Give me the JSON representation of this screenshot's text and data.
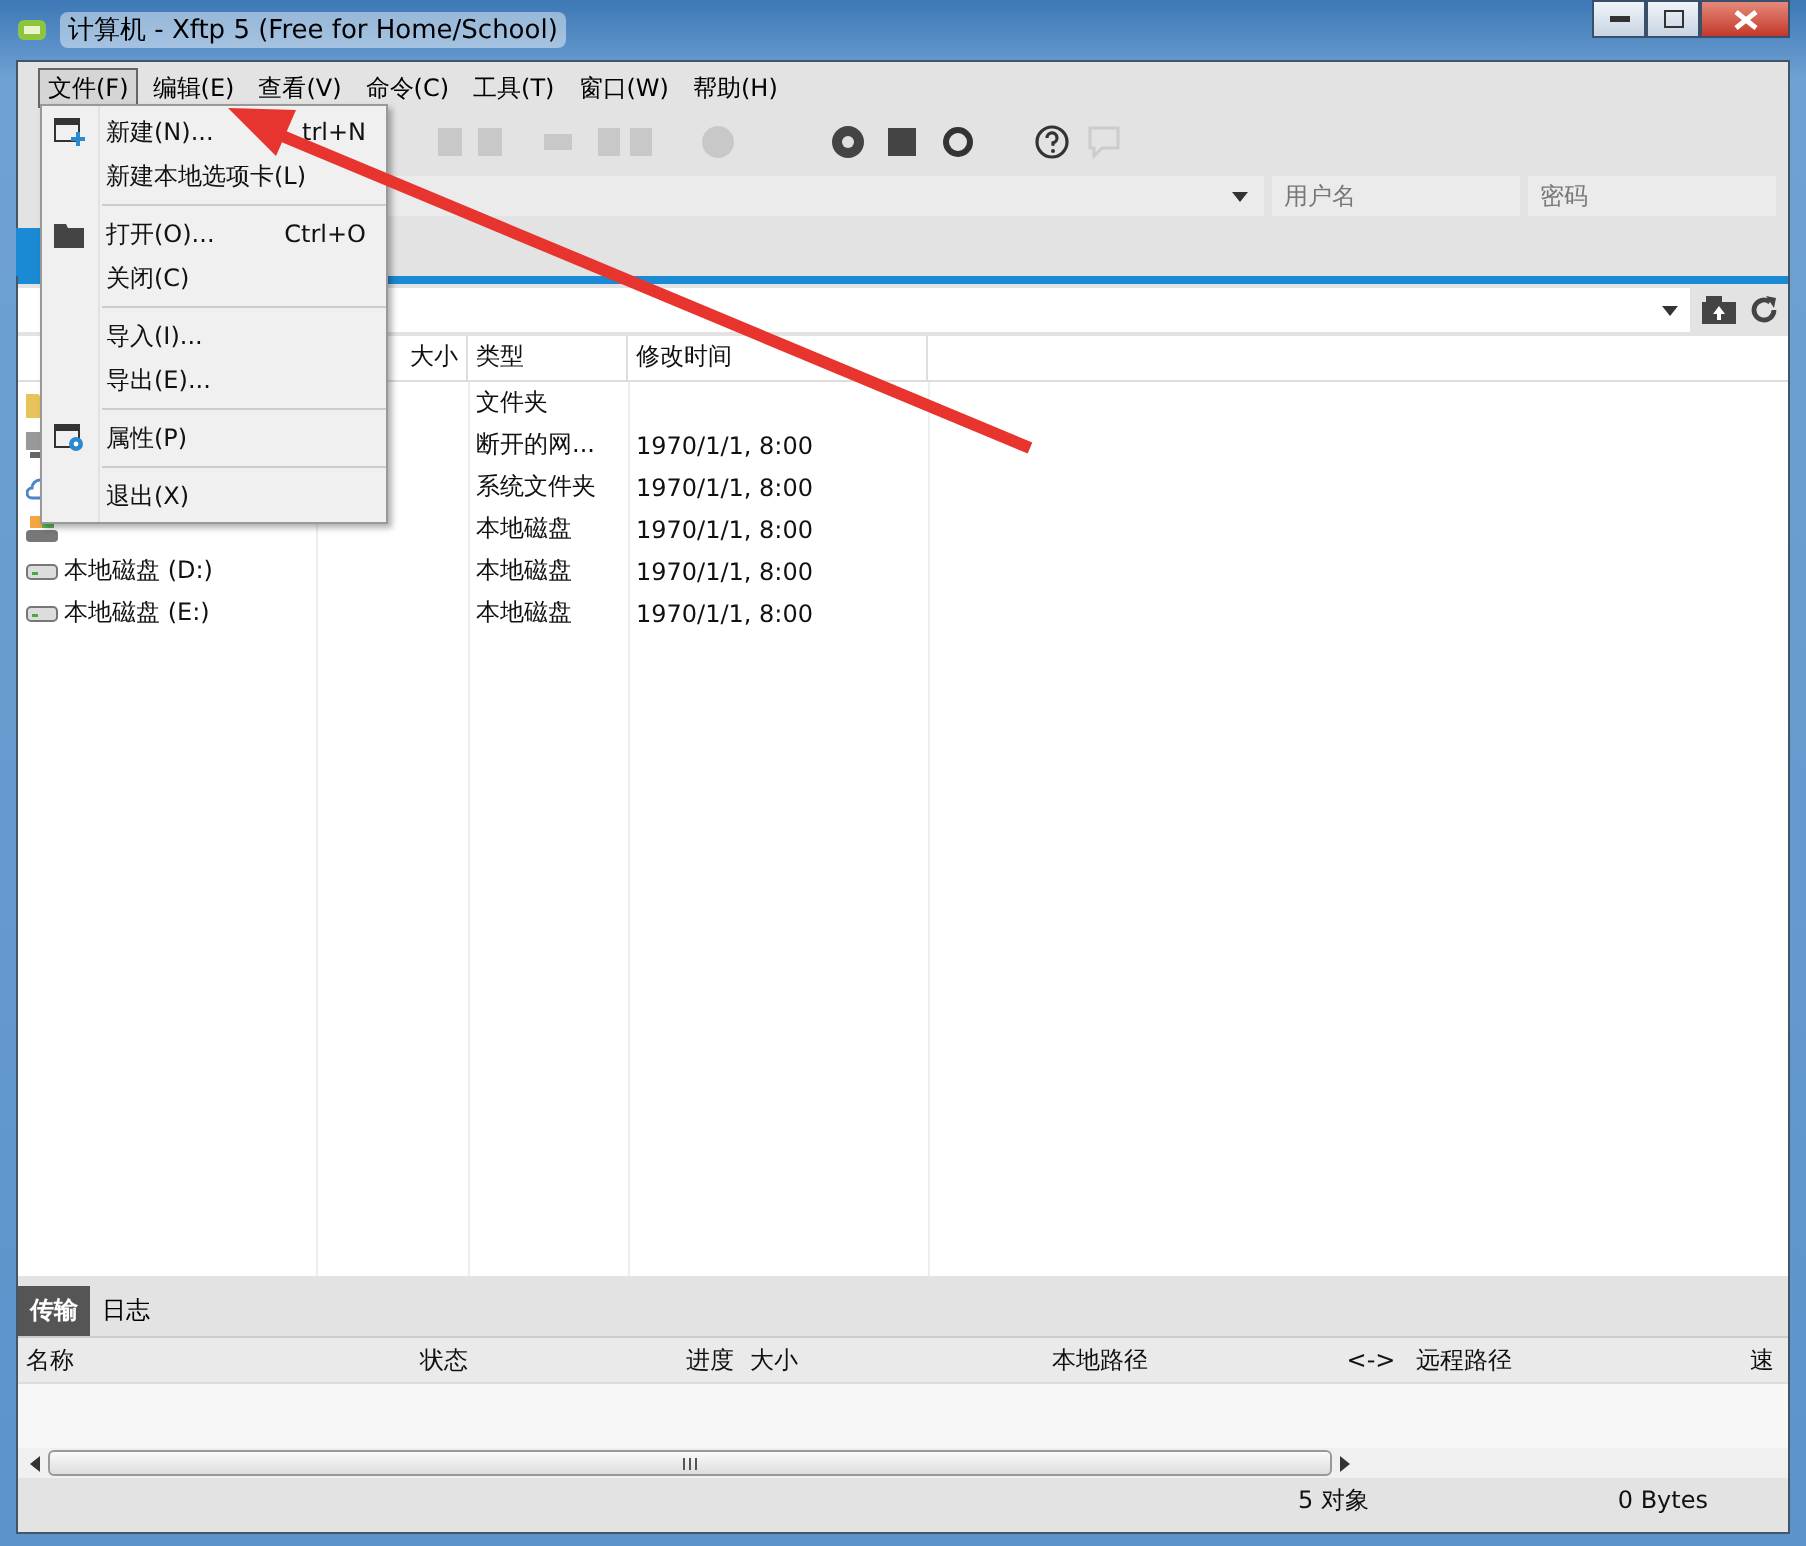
{
  "window": {
    "title": "计算机 - Xftp 5 (Free for Home/School)"
  },
  "menu_bar": [
    {
      "label": "文件(F)",
      "selected": true
    },
    {
      "label": "编辑(E)",
      "selected": false
    },
    {
      "label": "查看(V)",
      "selected": false
    },
    {
      "label": "命令(C)",
      "selected": false
    },
    {
      "label": "工具(T)",
      "selected": false
    },
    {
      "label": "窗口(W)",
      "selected": false
    },
    {
      "label": "帮助(H)",
      "selected": false
    }
  ],
  "file_menu": [
    {
      "kind": "new",
      "label": "新建(N)...",
      "shortcut": "trl+N"
    },
    {
      "kind": "plain",
      "label": "新建本地选项卡(L)"
    },
    {
      "kind": "separator"
    },
    {
      "kind": "open",
      "label": "打开(O)...",
      "shortcut": "Ctrl+O"
    },
    {
      "kind": "plain",
      "label": "关闭(C)"
    },
    {
      "kind": "separator"
    },
    {
      "kind": "plain",
      "label": "导入(I)..."
    },
    {
      "kind": "plain",
      "label": "导出(E)..."
    },
    {
      "kind": "separator"
    },
    {
      "kind": "properties",
      "label": "属性(P)"
    },
    {
      "kind": "separator"
    },
    {
      "kind": "plain",
      "label": "退出(X)"
    }
  ],
  "address_bar": {
    "username_placeholder": "用户名",
    "password_placeholder": "密码"
  },
  "file_list": {
    "columns": [
      "大小",
      "类型",
      "修改时间"
    ],
    "rows": [
      {
        "kind": "folder",
        "type": "文件夹"
      },
      {
        "kind": "network",
        "type": "断开的网...",
        "modified": "1970/1/1, 8:00"
      },
      {
        "kind": "cloud",
        "type": "系统文件夹",
        "modified": "1970/1/1, 8:00"
      },
      {
        "kind": "system-drive",
        "type": "本地磁盘",
        "modified": "1970/1/1, 8:00"
      },
      {
        "kind": "drive",
        "name": "本地磁盘 (D:)",
        "type": "本地磁盘",
        "modified": "1970/1/1, 8:00"
      },
      {
        "kind": "drive",
        "name": "本地磁盘 (E:)",
        "type": "本地磁盘",
        "modified": "1970/1/1, 8:00"
      }
    ]
  },
  "bottom_tabs": [
    {
      "label": "传输",
      "selected": true
    },
    {
      "label": "日志",
      "selected": false
    }
  ],
  "transfer_columns": [
    "名称",
    "状态",
    "进度",
    "大小",
    "本地路径",
    "<->",
    "远程路径",
    "速"
  ],
  "status_bar": {
    "objects": "5 对象",
    "size": "0 Bytes"
  }
}
